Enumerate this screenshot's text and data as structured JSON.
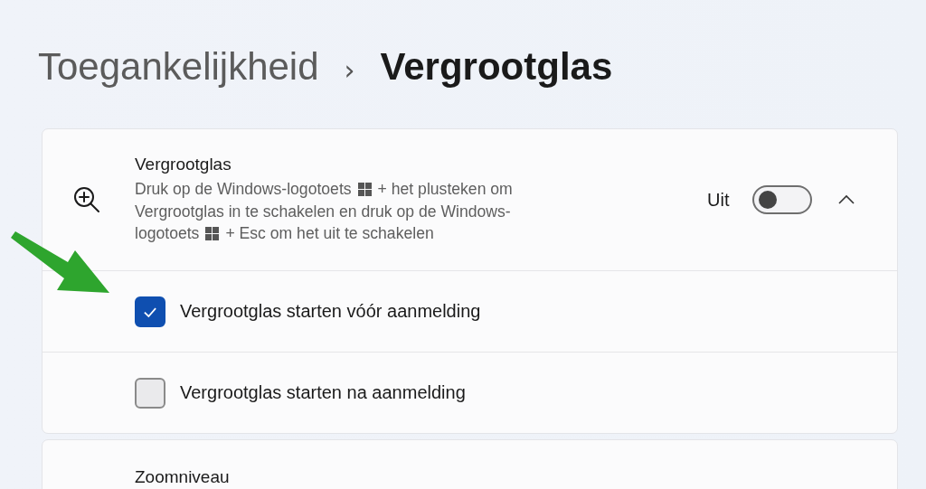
{
  "breadcrumb": {
    "parent": "Toegankelijkheid",
    "separator": "›",
    "current": "Vergrootglas"
  },
  "magnifier": {
    "title": "Vergrootglas",
    "description": [
      [
        {
          "kind": "text",
          "text": "Druk op de Windows-logotoets"
        },
        {
          "kind": "key"
        },
        {
          "kind": "text",
          "text": "+ het plusteken om"
        }
      ],
      [
        {
          "kind": "text",
          "text": "Vergrootglas in te schakelen en druk op de Windows-"
        }
      ],
      [
        {
          "kind": "text",
          "text": "logotoets"
        },
        {
          "kind": "key"
        },
        {
          "kind": "text",
          "text": "+ Esc om het uit te schakelen"
        }
      ]
    ],
    "state_label": "Uit",
    "on": false,
    "expanded": true,
    "options": [
      {
        "label": "Vergrootglas starten vóór aanmelding",
        "checked": true
      },
      {
        "label": "Vergrootglas starten na aanmelding",
        "checked": false
      }
    ]
  },
  "next_card": {
    "title": "Zoomniveau"
  }
}
